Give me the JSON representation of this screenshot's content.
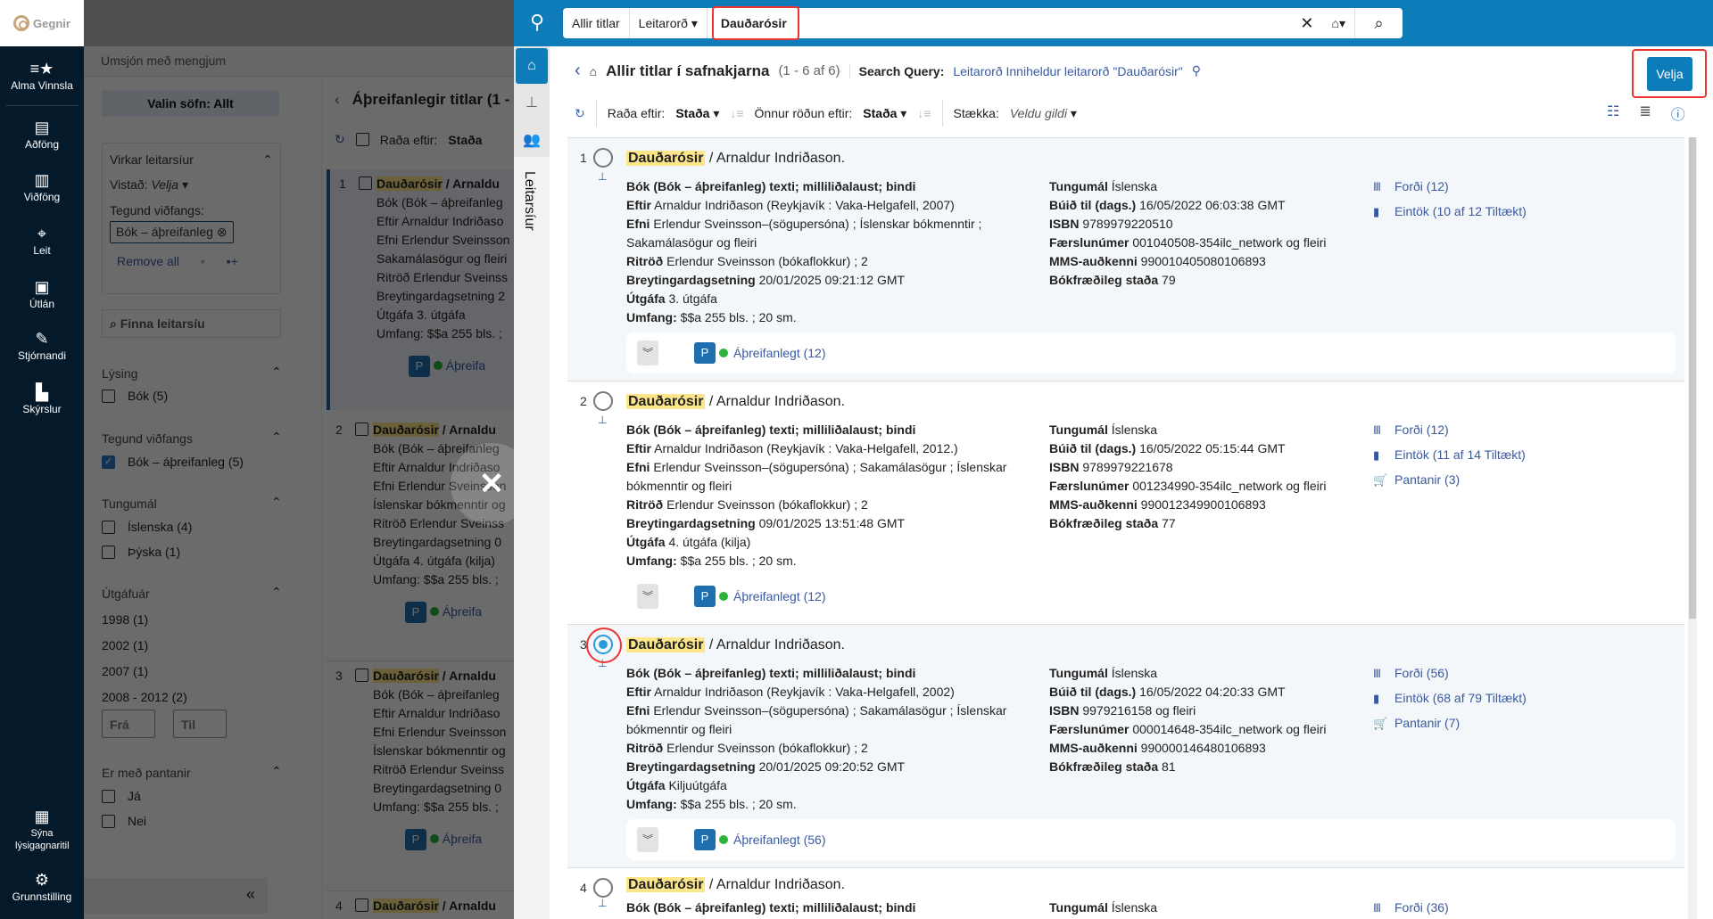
{
  "nav": {
    "logo": "Gegnir",
    "items": [
      {
        "label": "Alma Vinnsla",
        "icon": "list-star-icon"
      },
      {
        "label": "Aðföng",
        "icon": "ledger-icon"
      },
      {
        "label": "Viðföng",
        "icon": "books-icon"
      },
      {
        "label": "Leit",
        "icon": "telescope-icon"
      },
      {
        "label": "Útlán",
        "icon": "archive-icon"
      },
      {
        "label": "Stjórnandi",
        "icon": "admin-icon"
      },
      {
        "label": "Skýrslur",
        "icon": "bar-chart-icon"
      }
    ],
    "bottom": [
      {
        "label": "Sýna lýsigagnaritil",
        "icon": "metadata-editor-icon"
      },
      {
        "label": "Grunnstilling",
        "icon": "gear-icon"
      }
    ]
  },
  "background": {
    "subheader": "Umsjón með mengjum",
    "libraries_button": "Valin söfn: Allt",
    "active_filters": {
      "title": "Virkar leitarsíur",
      "location_label": "Vistað:",
      "location_value": "Velja",
      "type_label": "Tegund viðfangs:",
      "chip": "Bók – áþreifanleg",
      "remove_all": "Remove all"
    },
    "filter_search_placeholder": "Finna leitarsíu",
    "facets": {
      "description": {
        "title": "Lýsing",
        "options": [
          "Bók (5)"
        ]
      },
      "resource_type": {
        "title": "Tegund viðfangs",
        "options": [
          "Bók – áþreifanleg (5)"
        ]
      },
      "language": {
        "title": "Tungumál",
        "options": [
          "Íslenska (4)",
          "Þýska (1)"
        ]
      },
      "year": {
        "title": "Útgáfuár",
        "options": [
          "1998 (1)",
          "2002 (1)",
          "2007 (1)",
          "2008 - 2012 (2)"
        ],
        "from_placeholder": "Frá",
        "to_placeholder": "Til"
      },
      "orders": {
        "title": "Er með pantanir",
        "options": [
          "Já",
          "Nei"
        ]
      }
    },
    "list_title": "Áþreifanlegir titlar (1 -",
    "sort_label": "Raða eftir:",
    "sort_value": "Staða",
    "items": [
      {
        "num": "1",
        "title": "Dauðarósir",
        "rest": " / Arnaldu",
        "lines": [
          "Bók (Bók – áþreifanleg",
          "Eftir Arnaldur Indriðaso",
          "Efni Erlendur Sveinsson",
          "Sakamálasögur og fleiri",
          "Ritröð Erlendur Sveinss",
          "Breytingardagsetning 2",
          "Útgáfa 3. útgáfa",
          "Umfang: $$a 255 bls. ;"
        ],
        "avail": "Áþreifa"
      },
      {
        "num": "2",
        "title": "Dauðarósir",
        "rest": " / Arnaldu",
        "lines": [
          "Bók (Bók – áþreifanleg",
          "Eftir Arnaldur Indriðaso",
          "Efni Erlendur Sveinsson",
          "Íslenskar bókmenntir og",
          "Ritröð Erlendur Sveinss",
          "Breytingardagsetning 0",
          "Útgáfa 4. útgáfa (kilja)",
          "Umfang: $$a 255 bls. ;"
        ],
        "avail": "Áþreifa"
      },
      {
        "num": "3",
        "title": "Dauðarósir",
        "rest": " / Arnaldu",
        "lines": [
          "Bók (Bók – áþreifanleg",
          "Eftir Arnaldur Indriðaso",
          "Efni Erlendur Sveinsson",
          "Íslenskar bókmenntir og",
          "Ritröð Erlendur Sveinss",
          "Breytingardagsetning 0",
          "Umfang: $$a 255 bls. ;"
        ],
        "avail": "Áþreifa"
      },
      {
        "num": "4",
        "title": "Dauðarósir",
        "rest": " / Arnaldu",
        "lines": [],
        "avail": ""
      }
    ]
  },
  "panel": {
    "search": {
      "scope": "Allir titlar",
      "field": "Leitarorð",
      "query": "Dauðarósir"
    },
    "side_tab": "Leitarsíur",
    "header": {
      "title": "Allir titlar í safnakjarna",
      "count": "(1 - 6 af 6)",
      "query_label": "Search Query:",
      "query_value": "Leitarorð Inniheldur leitarorð \"Dauðarósir\"",
      "select_button": "Velja"
    },
    "toolbar": {
      "sort_label": "Raða eftir:",
      "sort_value": "Staða",
      "secondary_sort_label": "Önnur röðun eftir:",
      "secondary_sort_value": "Staða",
      "expand_label": "Stækka:",
      "expand_value": "Veldu gildi"
    },
    "results": [
      {
        "num": "1",
        "title_hl": "Dauðarósir",
        "title_rest": " / Arnaldur Indriðason.",
        "type": "Bók (Bók – áþreifanleg) texti; milliliðalaust; bindi",
        "left": [
          {
            "k": "Eftir",
            "v": "Arnaldur Indriðason (Reykjavík : Vaka-Helgafell, 2007)"
          },
          {
            "k": "Efni",
            "v": "Erlendur Sveinsson–(sögupersóna) ; Íslenskar bókmenntir ; Sakamálasögur og fleiri"
          },
          {
            "k": "Ritröð",
            "v": "Erlendur Sveinsson (bókaflokkur) ; 2"
          },
          {
            "k": "Breytingardagsetning",
            "v": "20/01/2025 09:21:12 GMT"
          },
          {
            "k": "Útgáfa",
            "v": "3. útgáfa"
          },
          {
            "k": "Umfang:",
            "v": "$$a 255 bls. ; 20 sm."
          }
        ],
        "right": [
          {
            "k": "Tungumál",
            "v": "Íslenska"
          },
          {
            "k": "Búið til (dags.)",
            "v": "16/05/2022 06:03:38 GMT"
          },
          {
            "k": "ISBN",
            "v": "9789979220510"
          },
          {
            "k": "Færslunúmer",
            "v": "001040508-354ilc_network og fleiri"
          },
          {
            "k": "MMS-auðkenni",
            "v": "990010405080106893"
          },
          {
            "k": "Bókfræðileg staða",
            "v": "79"
          }
        ],
        "links": [
          "Forði (12)",
          "Eintök (10 af 12 Tiltækt)"
        ],
        "availability": "Áþreifanlegt (12)"
      },
      {
        "num": "2",
        "title_hl": "Dauðarósir",
        "title_rest": " / Arnaldur Indriðason.",
        "type": "Bók (Bók – áþreifanleg) texti; milliliðalaust; bindi",
        "left": [
          {
            "k": "Eftir",
            "v": "Arnaldur Indriðason (Reykjavík : Vaka-Helgafell, 2012.)"
          },
          {
            "k": "Efni",
            "v": "Erlendur Sveinsson–(sögupersóna) ; Sakamálasögur ; Íslenskar bókmenntir og fleiri"
          },
          {
            "k": "Ritröð",
            "v": "Erlendur Sveinsson (bókaflokkur) ; 2"
          },
          {
            "k": "Breytingardagsetning",
            "v": "09/01/2025 13:51:48 GMT"
          },
          {
            "k": "Útgáfa",
            "v": "4. útgáfa (kilja)"
          },
          {
            "k": "Umfang:",
            "v": "$$a 255 bls. ; 20 sm."
          }
        ],
        "right": [
          {
            "k": "Tungumál",
            "v": "Íslenska"
          },
          {
            "k": "Búið til (dags.)",
            "v": "16/05/2022 05:15:44 GMT"
          },
          {
            "k": "ISBN",
            "v": "9789979221678"
          },
          {
            "k": "Færslunúmer",
            "v": "001234990-354ilc_network og fleiri"
          },
          {
            "k": "MMS-auðkenni",
            "v": "990012349900106893"
          },
          {
            "k": "Bókfræðileg staða",
            "v": "77"
          }
        ],
        "links": [
          "Forði (12)",
          "Eintök (11 af 14 Tiltækt)",
          "Pantanir (3)"
        ],
        "availability": "Áþreifanlegt (12)"
      },
      {
        "num": "3",
        "title_hl": "Dauðarósir",
        "title_rest": " / Arnaldur Indriðason.",
        "type": "Bók (Bók – áþreifanleg) texti; milliliðalaust; bindi",
        "left": [
          {
            "k": "Eftir",
            "v": "Arnaldur Indriðason (Reykjavík : Vaka-Helgafell, 2002)"
          },
          {
            "k": "Efni",
            "v": "Erlendur Sveinsson–(sögupersóna) ; Sakamálasögur ; Íslenskar bókmenntir og fleiri"
          },
          {
            "k": "Ritröð",
            "v": "Erlendur Sveinsson (bókaflokkur) ; 2"
          },
          {
            "k": "Breytingardagsetning",
            "v": "20/01/2025 09:20:52 GMT"
          },
          {
            "k": "Útgáfa",
            "v": "Kiljuútgáfa"
          },
          {
            "k": "Umfang:",
            "v": "$$a 255 bls. ; 20 sm."
          }
        ],
        "right": [
          {
            "k": "Tungumál",
            "v": "Íslenska"
          },
          {
            "k": "Búið til (dags.)",
            "v": "16/05/2022 04:20:33 GMT"
          },
          {
            "k": "ISBN",
            "v": "9979216158 og fleiri"
          },
          {
            "k": "Færslunúmer",
            "v": "000014648-354ilc_network og fleiri"
          },
          {
            "k": "MMS-auðkenni",
            "v": "990000146480106893"
          },
          {
            "k": "Bókfræðileg staða",
            "v": "81"
          }
        ],
        "links": [
          "Forði (56)",
          "Eintök (68 af 79 Tiltækt)",
          "Pantanir (7)"
        ],
        "availability": "Áþreifanlegt (56)",
        "active": true
      },
      {
        "num": "4",
        "title_hl": "Dauðarósir",
        "title_rest": " / Arnaldur Indriðason.",
        "type": "Bók (Bók – áþreifanleg) texti; milliliðalaust; bindi",
        "left": [],
        "right": [
          {
            "k": "Tungumál",
            "v": "Íslenska"
          }
        ],
        "links": [
          "Forði (36)"
        ],
        "availability": ""
      }
    ]
  },
  "colors": {
    "brand_blue": "#0f7cba",
    "nav_bg": "#041a2b",
    "highlight": "#fde68a",
    "link": "#3a5aa0",
    "available": "#2bb33b",
    "annotation_red": "#ee3333"
  }
}
